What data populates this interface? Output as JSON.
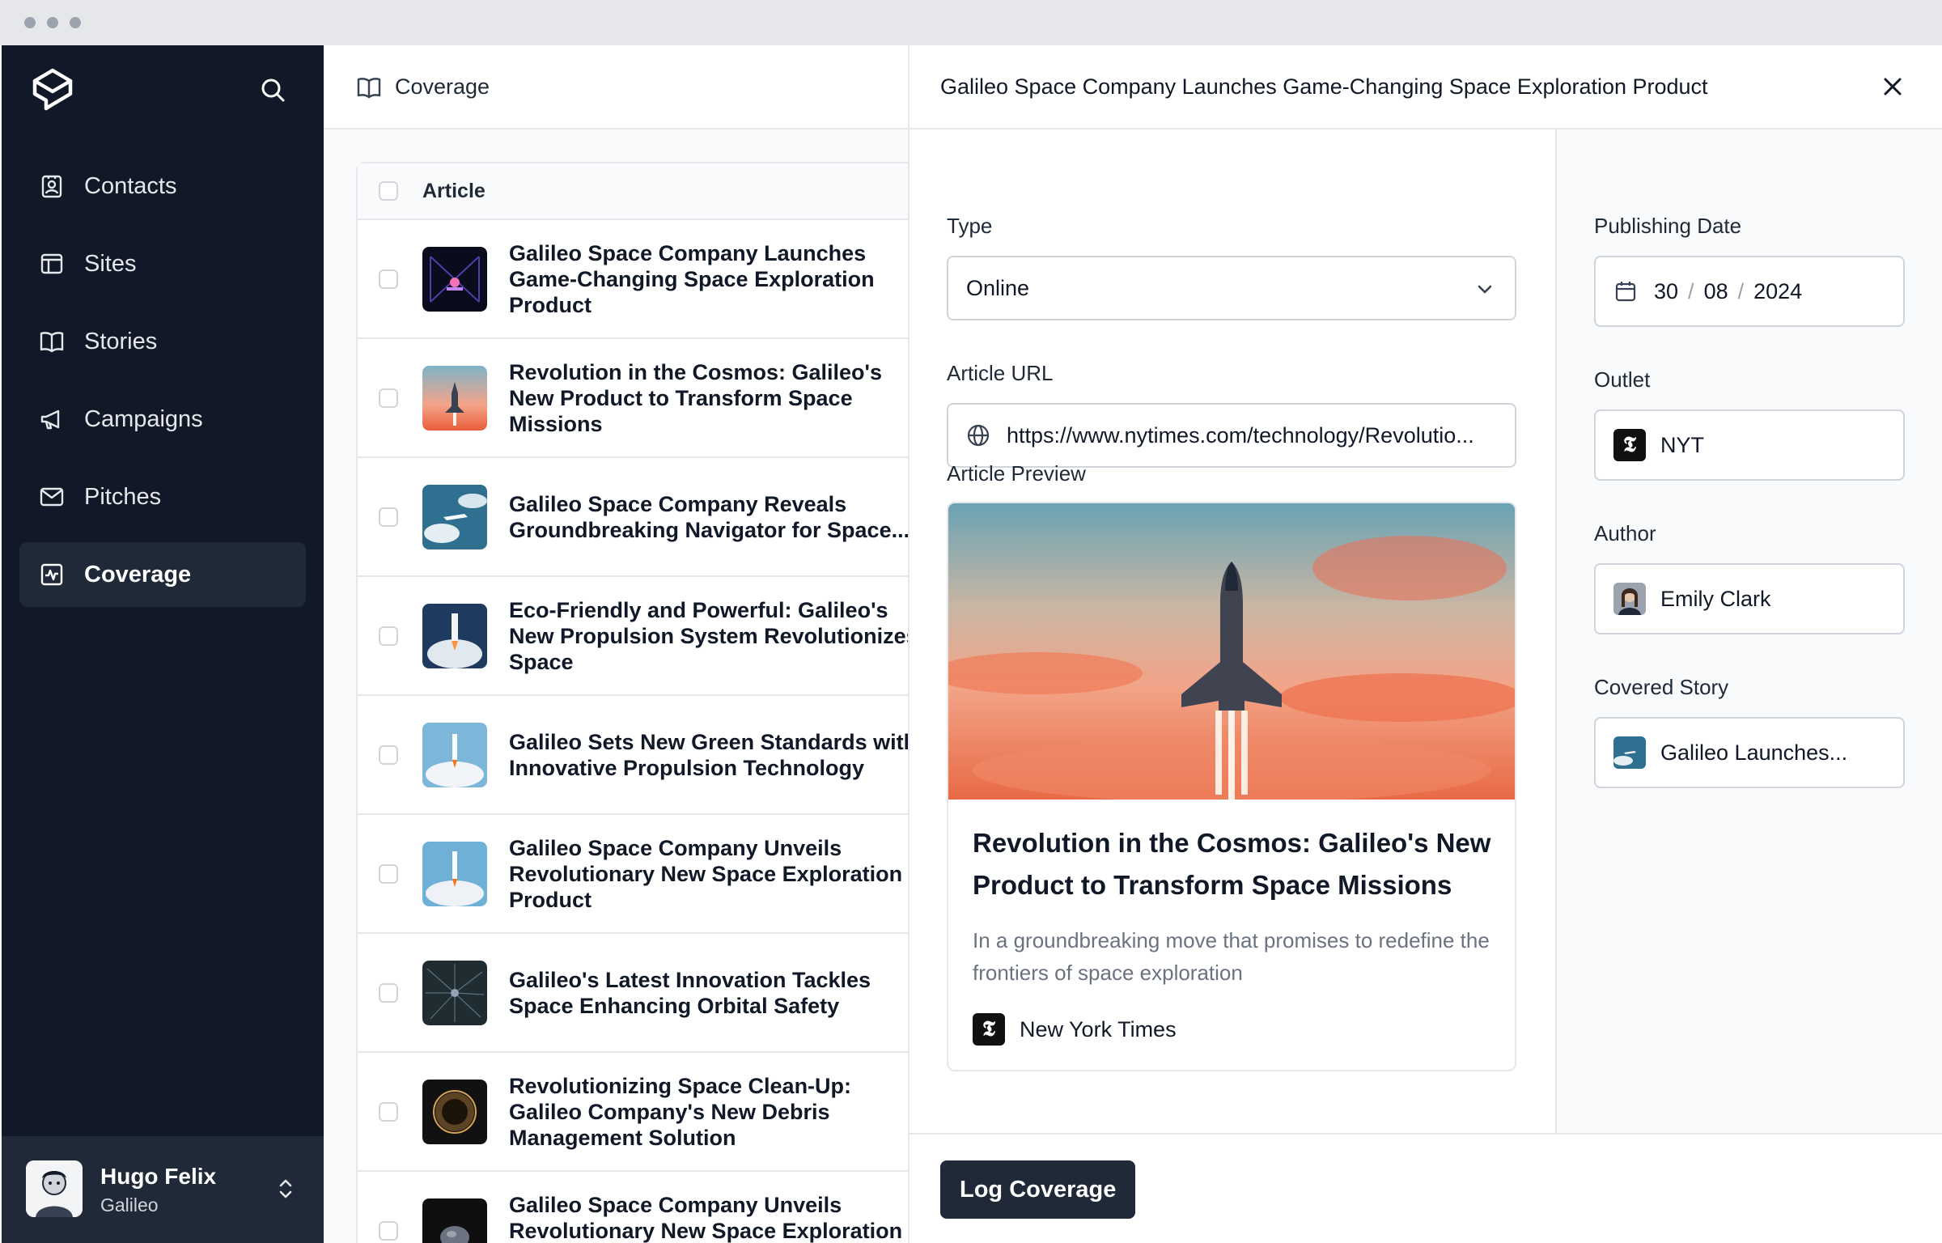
{
  "sidebar": {
    "items": [
      {
        "label": "Contacts",
        "icon": "contacts-icon"
      },
      {
        "label": "Sites",
        "icon": "sites-icon"
      },
      {
        "label": "Stories",
        "icon": "stories-icon"
      },
      {
        "label": "Campaigns",
        "icon": "megaphone-icon"
      },
      {
        "label": "Pitches",
        "icon": "mail-icon"
      },
      {
        "label": "Coverage",
        "icon": "coverage-icon",
        "active": true
      }
    ],
    "user": {
      "name": "Hugo Felix",
      "org": "Galileo"
    }
  },
  "list": {
    "header_title": "Coverage",
    "column_article": "Article",
    "rows": [
      {
        "title": "Galileo Space Company Launches Game-Changing Space Exploration Product"
      },
      {
        "title": "Revolution in the Cosmos: Galileo's New Product to Transform Space Missions"
      },
      {
        "title": "Galileo Space Company Reveals Groundbreaking Navigator for Space..."
      },
      {
        "title": "Eco-Friendly and Powerful: Galileo's New Propulsion System Revolutionizes Space"
      },
      {
        "title": "Galileo Sets New Green Standards with Innovative Propulsion Technology"
      },
      {
        "title": "Galileo Space Company Unveils Revolutionary New Space Exploration Product"
      },
      {
        "title": "Galileo's Latest Innovation Tackles Space Enhancing Orbital Safety"
      },
      {
        "title": "Revolutionizing Space Clean-Up: Galileo Company's New Debris Management Solution"
      },
      {
        "title": "Galileo Space Company Unveils Revolutionary New Space Exploration Product"
      }
    ]
  },
  "panel": {
    "title": "Galileo Space Company Launches Game-Changing Space Exploration Product",
    "type_label": "Type",
    "type_value": "Online",
    "url_label": "Article URL",
    "url_value": "https://www.nytimes.com/technology/Revolutio...",
    "preview_label": "Article Preview",
    "preview_title": "Revolution in the Cosmos: Galileo's New Product to Transform Space Missions",
    "preview_desc": "In a groundbreaking move that promises to redefine the frontiers of space exploration",
    "preview_source": "New York Times",
    "date_label": "Publishing Date",
    "date_day": "30",
    "date_month": "08",
    "date_year": "2024",
    "date_sep": "/",
    "outlet_label": "Outlet",
    "outlet_value": "NYT",
    "nyt_glyph": "𝕿",
    "author_label": "Author",
    "author_value": "Emily Clark",
    "story_label": "Covered Story",
    "story_value": "Galileo Launches...",
    "log_button": "Log Coverage"
  },
  "colors": {
    "sidebar_bg": "#111827",
    "active_bg": "#1f2937",
    "button_bg": "#1f2937"
  }
}
